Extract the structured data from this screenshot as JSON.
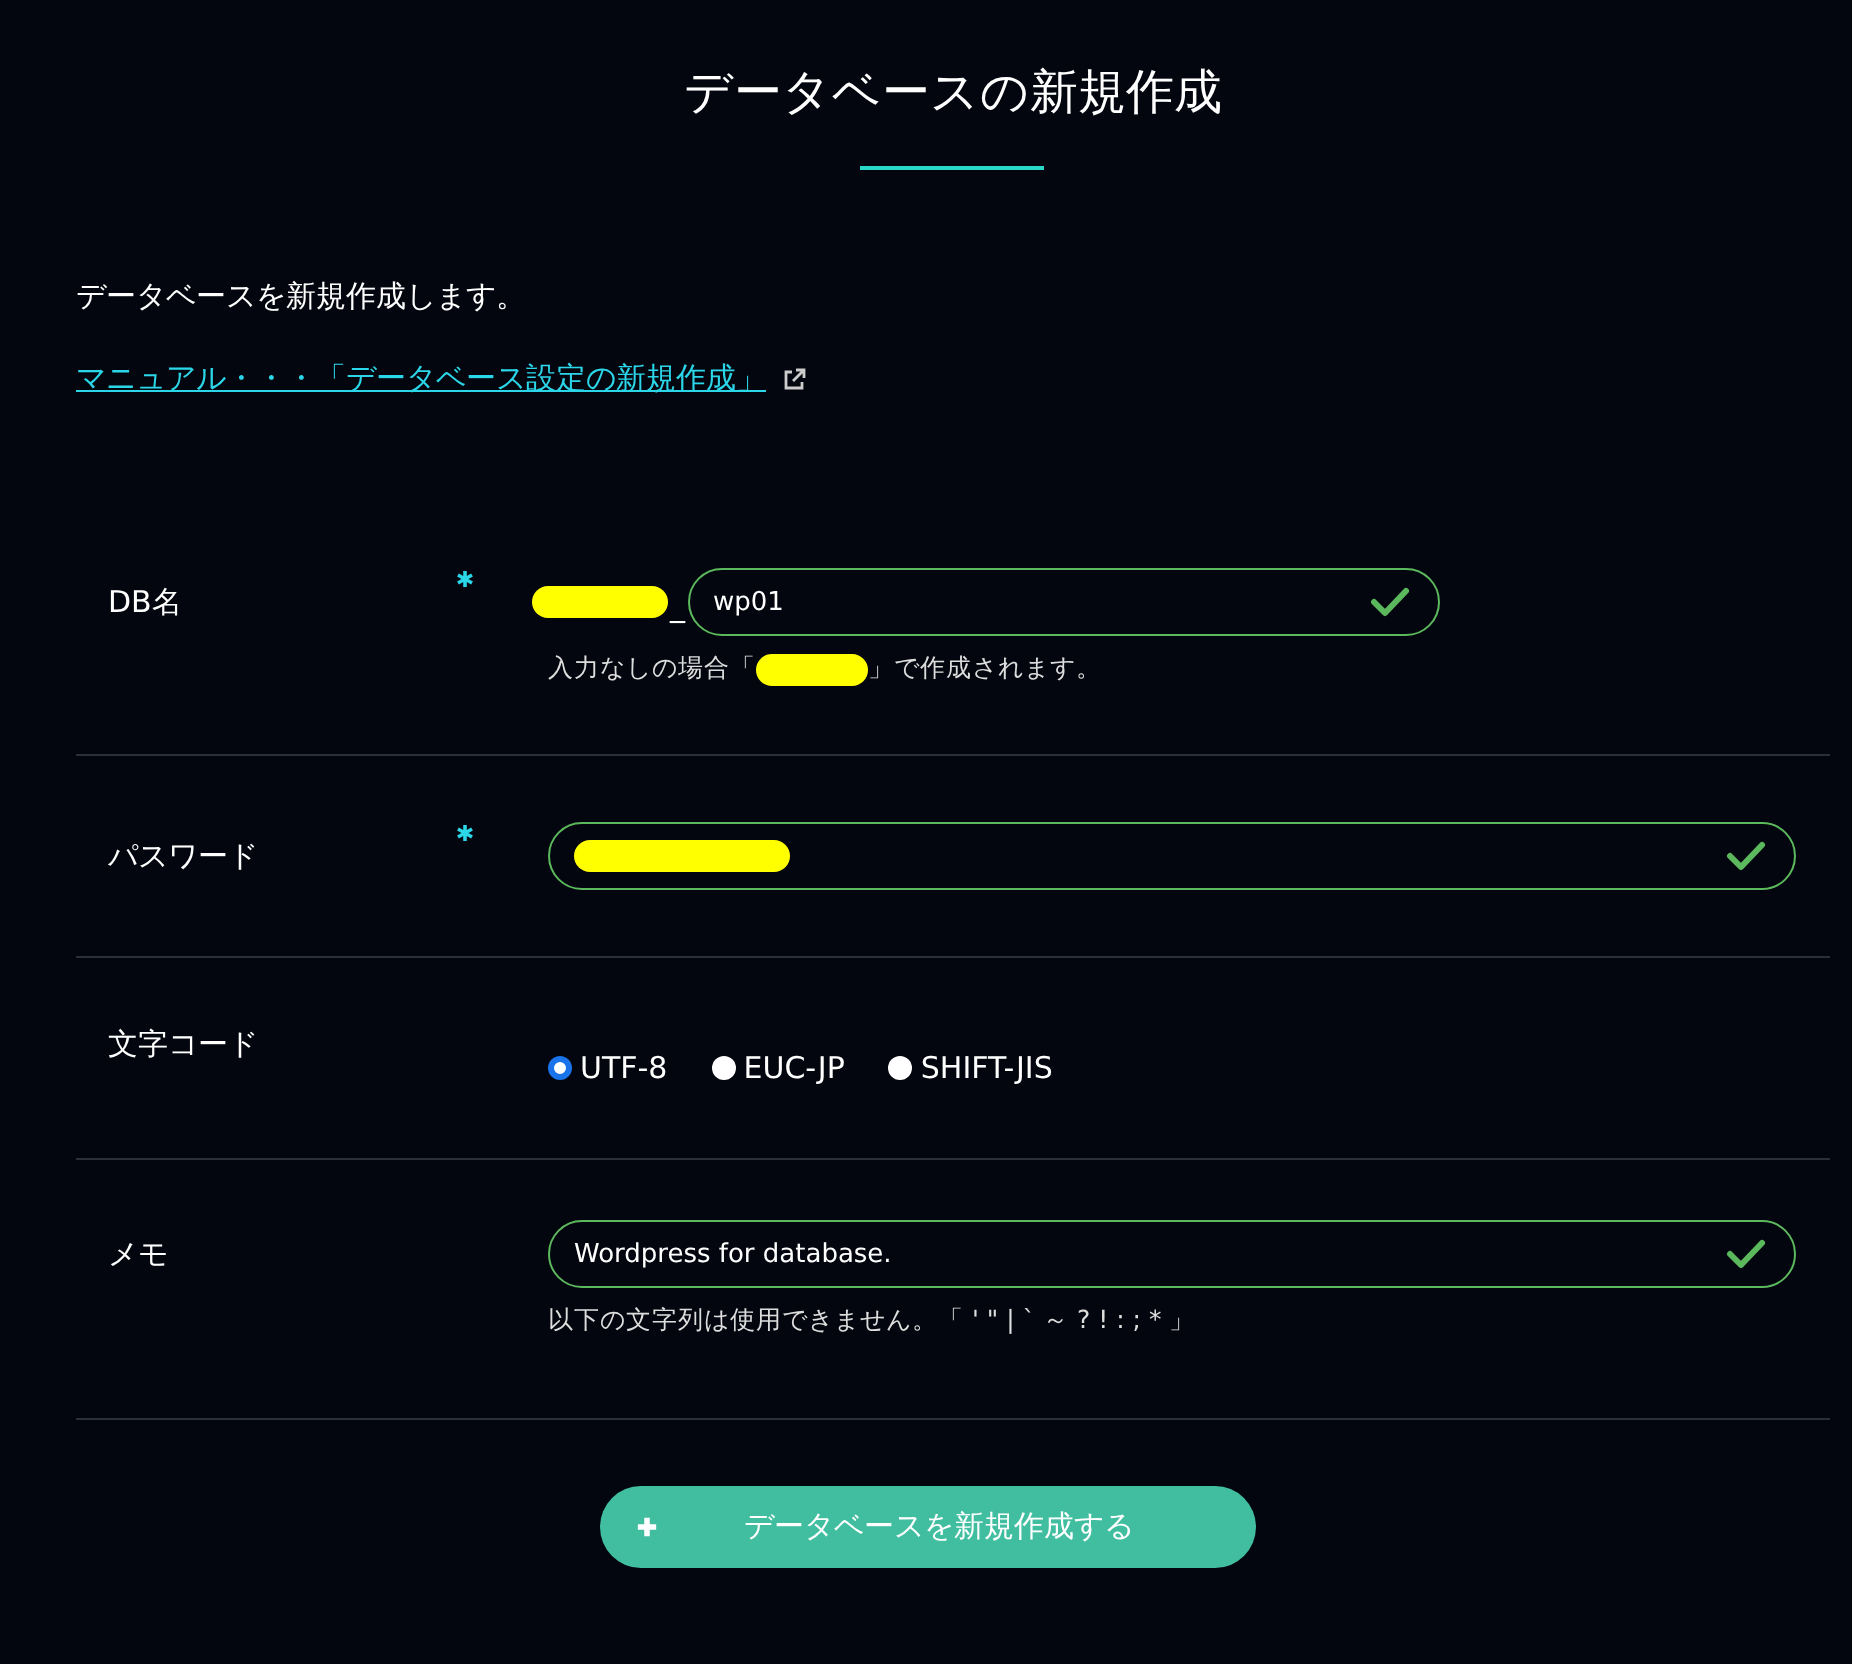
{
  "dialog": {
    "title": "データベースの新規作成",
    "intro": "データベースを新規作成します。",
    "manual_link": "マニュアル・・・「データベース設定の新規作成」"
  },
  "fields": [
    {
      "kind": "prefixed",
      "label": "DB名",
      "required": true,
      "separator": "_",
      "value": "wp01",
      "valid": true,
      "hint_before": "入力なしの場合「",
      "hint_after": "」で作成されます。"
    },
    {
      "kind": "password",
      "label": "パスワード",
      "required": true,
      "valid": true
    },
    {
      "kind": "radio",
      "label": "文字コード",
      "required": false,
      "options": [
        {
          "label": "UTF-8",
          "selected": true
        },
        {
          "label": "EUC-JP",
          "selected": false
        },
        {
          "label": "SHIFT-JIS",
          "selected": false
        }
      ]
    },
    {
      "kind": "text",
      "label": "メモ",
      "required": false,
      "value": "Wordpress for database.",
      "valid": true,
      "hint": "以下の文字列は使用できません。「 ' \" | ` ～ ? ! : ; * 」"
    }
  ],
  "submit": {
    "label": "データベースを新規作成する"
  }
}
